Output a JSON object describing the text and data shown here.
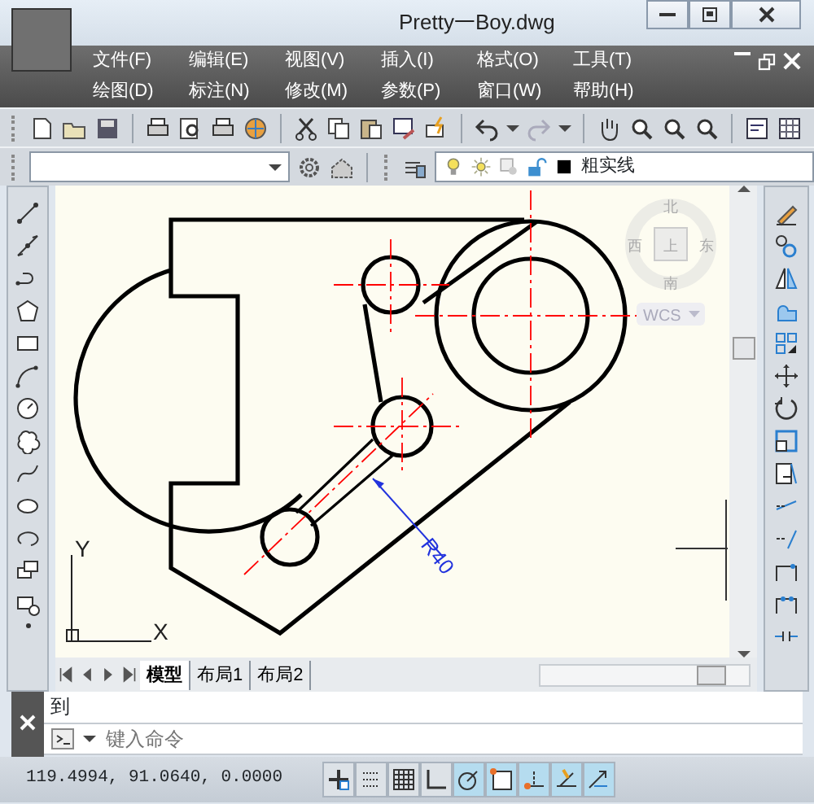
{
  "window": {
    "title": "Pretty一Boy.dwg"
  },
  "menu_bar": {
    "rows": [
      [
        "文件(F)",
        "编辑(E)",
        "视图(V)",
        "插入(I)",
        "格式(O)",
        "工具(T)"
      ],
      [
        "绘图(D)",
        "标注(N)",
        "修改(M)",
        "参数(P)",
        "窗口(W)",
        "帮助(H)"
      ]
    ]
  },
  "layer_toolbar": {
    "linetype": "粗实线"
  },
  "viewcube": {
    "north": "北",
    "west": "西",
    "east": "东",
    "south": "南",
    "face": "上",
    "ucs": "WCS"
  },
  "drawing": {
    "dimension": "R40",
    "axis_x": "X",
    "axis_y": "Y"
  },
  "layout_tabs": [
    {
      "label": "模型",
      "selected": true
    },
    {
      "label": "布局1",
      "selected": false
    },
    {
      "label": "布局2",
      "selected": false
    }
  ],
  "command_line": {
    "history": "到",
    "placeholder": "键入命令"
  },
  "status_bar": {
    "coordinates": "119.4994, 91.0640, 0.0000",
    "toggles": [
      {
        "on": false
      },
      {
        "on": false
      },
      {
        "on": false
      },
      {
        "on": false
      },
      {
        "on": true
      },
      {
        "on": true
      },
      {
        "on": true
      },
      {
        "on": true
      },
      {
        "on": true
      }
    ]
  }
}
